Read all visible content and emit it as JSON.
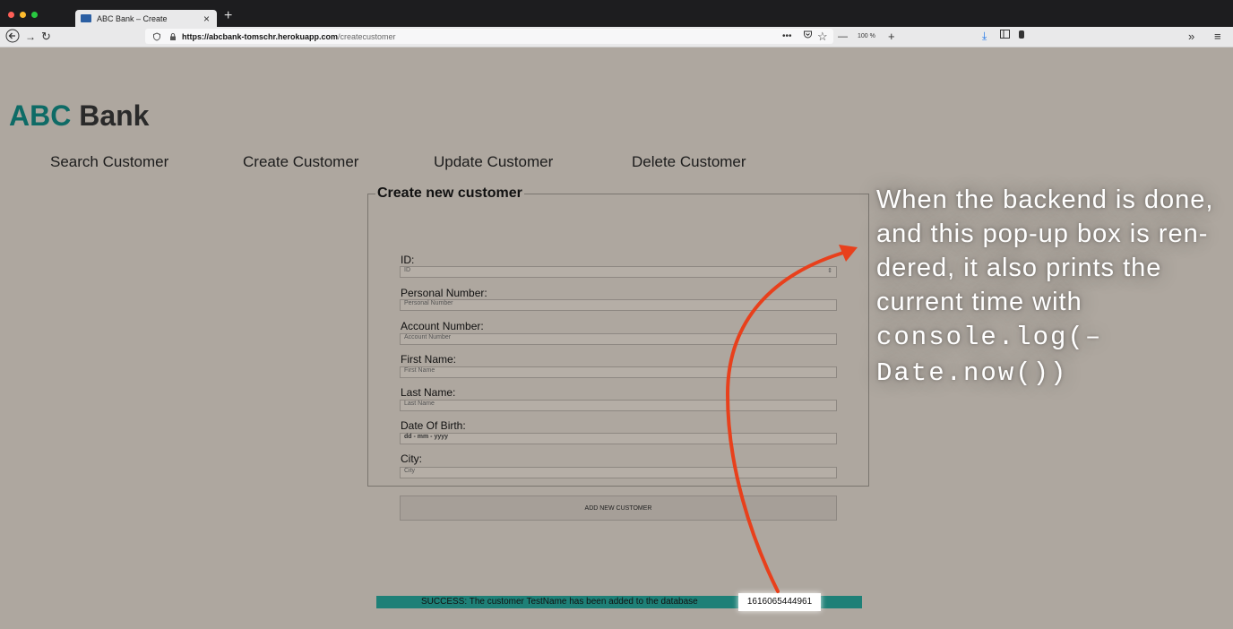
{
  "browser": {
    "tab_title": "ABC Bank – Create",
    "tab_close": "×",
    "new_tab": "+",
    "url_host": "https://abcbank-tomschr.herokuapp.com",
    "url_path": "/createcustomer",
    "zoom": "100 %",
    "zoom_out": "—",
    "zoom_in": "+",
    "more": "•••",
    "overflow": "»",
    "menu": "≡"
  },
  "page": {
    "brand_abc": "ABC",
    "brand_bank": " Bank",
    "nav": [
      "Search Customer",
      "Create Customer",
      "Update Customer",
      "Delete Customer"
    ]
  },
  "form": {
    "legend": "Create new customer",
    "fields": [
      {
        "label": "ID:",
        "placeholder": "ID"
      },
      {
        "label": "Personal Number:",
        "placeholder": "Personal Number"
      },
      {
        "label": "Account Number:",
        "placeholder": "Account Number"
      },
      {
        "label": "First Name:",
        "placeholder": "First Name"
      },
      {
        "label": "Last Name:",
        "placeholder": "Last Name"
      },
      {
        "label": "Date Of Birth:",
        "placeholder": "dd - mm - yyyy"
      },
      {
        "label": "City:",
        "placeholder": "City"
      }
    ],
    "spinner": "⇕",
    "submit_label": "ADD NEW CUSTOMER"
  },
  "status": {
    "message": "SUCCESS: The customer TestName has been added to the database",
    "timestamp": "1616065444961"
  },
  "annotation": {
    "text": "When the backend is done, and this pop-up box is ren-dered, it also prints the current time with",
    "code": "console.log(–Date.now())"
  },
  "colors": {
    "brand": "#0e6b66",
    "success": "#1e8077",
    "arrow": "#e8401c"
  }
}
